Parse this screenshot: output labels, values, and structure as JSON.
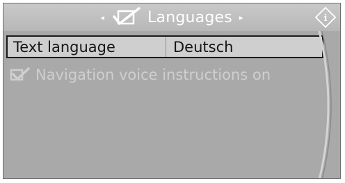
{
  "header": {
    "title": "Languages",
    "left_arrow": "◂",
    "right_arrow": "▸",
    "title_icon": "checkbox-check-icon",
    "info_icon": "info-diamond-icon",
    "info_glyph": "i"
  },
  "menu": {
    "rows": [
      {
        "label": "Text language",
        "value": "Deutsch",
        "selected": true
      },
      {
        "label": "Navigation voice instructions on",
        "checked": true,
        "enabled": false
      }
    ]
  },
  "colors": {
    "background": "#a9a9a9",
    "titlebar": "#c0c0c0",
    "selection_border": "#1a1a1a",
    "disabled_text": "#cfcfcf"
  }
}
